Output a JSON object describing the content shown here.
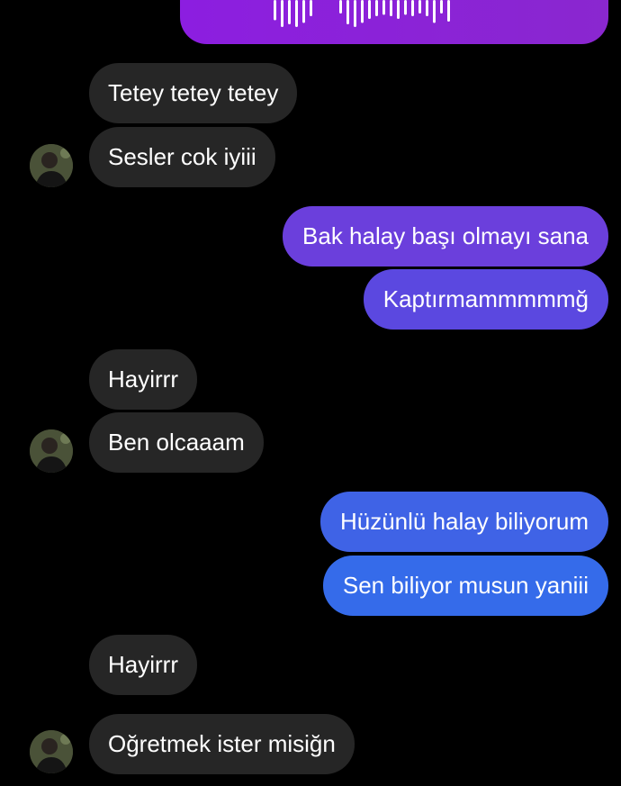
{
  "voice_message": {
    "bars": [
      0.75,
      1,
      0.9,
      1,
      0.85,
      0.6,
      0,
      0,
      0,
      0,
      0,
      0.5,
      0.9,
      1,
      0.85,
      0.7,
      0.6,
      0.55,
      0.6,
      0.7,
      0.55,
      0.6,
      0.5,
      0.6,
      0.85,
      0.5,
      0.8
    ],
    "bar_color": "#ffffff"
  },
  "messages": [
    {
      "side": "in",
      "text": "Tetey tetey tetey"
    },
    {
      "side": "in",
      "text": "Sesler cok iyiii"
    },
    {
      "side": "out",
      "text": "Bak halay başı olmayı sana",
      "color": "#6b3fdc"
    },
    {
      "side": "out",
      "text": "Kaptırmammmmmğ",
      "color": "#5b48e0"
    },
    {
      "side": "in",
      "text": "Hayirrr"
    },
    {
      "side": "in",
      "text": "Ben olcaaam"
    },
    {
      "side": "out",
      "text": "Hüzünlü halay biliyorum",
      "color": "#3f63e6"
    },
    {
      "side": "out",
      "text": "Sen biliyor musun yaniii",
      "color": "#356bea"
    },
    {
      "side": "in",
      "text": "Hayirrr"
    },
    {
      "side": "in",
      "text": "Oğretmek ister misiğn"
    }
  ],
  "colors": {
    "background": "#000000",
    "incoming_bubble": "#262626",
    "voice_bubble": "#8a22d4",
    "text": "#ffffff"
  }
}
